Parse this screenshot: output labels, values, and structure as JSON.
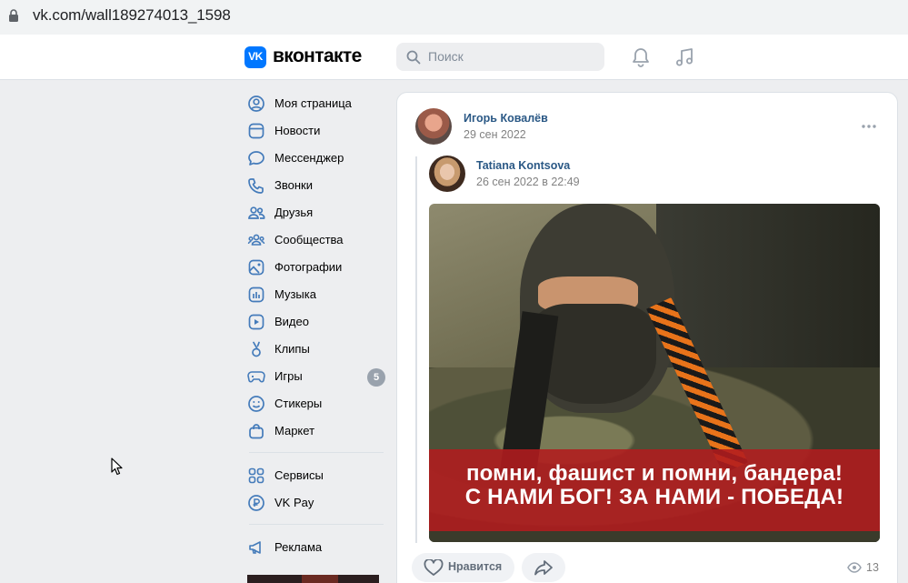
{
  "browser": {
    "url": "vk.com/wall189274013_1598"
  },
  "header": {
    "logo_mark": "VK",
    "logo_text": "вконтакте",
    "search_placeholder": "Поиск",
    "bell_icon": "bell-icon",
    "music_icon": "music-icon"
  },
  "menu": {
    "items": [
      {
        "label": "Моя страница",
        "icon": "user-circle-icon"
      },
      {
        "label": "Новости",
        "icon": "newsfeed-icon"
      },
      {
        "label": "Мессенджер",
        "icon": "message-icon"
      },
      {
        "label": "Звонки",
        "icon": "phone-icon"
      },
      {
        "label": "Друзья",
        "icon": "friends-icon"
      },
      {
        "label": "Сообщества",
        "icon": "communities-icon"
      },
      {
        "label": "Фотографии",
        "icon": "photo-icon"
      },
      {
        "label": "Музыка",
        "icon": "music-icon"
      },
      {
        "label": "Видео",
        "icon": "video-icon"
      },
      {
        "label": "Клипы",
        "icon": "clips-icon"
      },
      {
        "label": "Игры",
        "icon": "gamepad-icon",
        "badge": "5"
      },
      {
        "label": "Стикеры",
        "icon": "smile-icon"
      },
      {
        "label": "Маркет",
        "icon": "bag-icon"
      }
    ],
    "items2": [
      {
        "label": "Сервисы",
        "icon": "services-icon"
      },
      {
        "label": "VK Pay",
        "icon": "vkpay-icon"
      }
    ],
    "items3": [
      {
        "label": "Реклама",
        "icon": "megaphone-icon"
      }
    ]
  },
  "post": {
    "author": "Игорь Ковалёв",
    "date": "29 сен 2022",
    "repost": {
      "author": "Tatiana Kontsova",
      "date": "26 сен 2022 в 22:49",
      "image_caption_line1": "помни, фашист и помни, бандера!",
      "image_caption_line2": "С НАМИ БОГ! ЗА НАМИ - ПОБЕДА!"
    },
    "like_label": "Нравится",
    "views": "13"
  },
  "colors": {
    "accent": "#0077ff",
    "link": "#2a5885",
    "page_bg": "#edeef0",
    "banner_red": "#b21b1e"
  }
}
